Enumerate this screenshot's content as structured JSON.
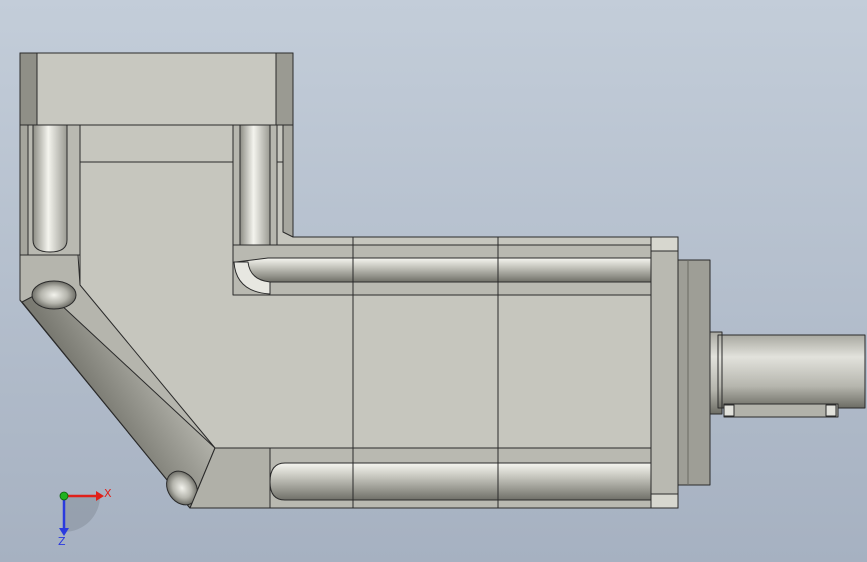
{
  "viewport": {
    "background_top": "#c3cdd9",
    "background_bottom": "#a6b1c1"
  },
  "model": {
    "body_color": "#c6c6be",
    "edge_color": "#2a2a2a",
    "shadow_color": "#85857d",
    "highlight_color": "#f4f4ee"
  },
  "triad": {
    "x_label": "X",
    "z_label": "Z",
    "x_color": "#e0201a",
    "y_color": "#1fb21f",
    "z_color": "#2a3adf"
  }
}
